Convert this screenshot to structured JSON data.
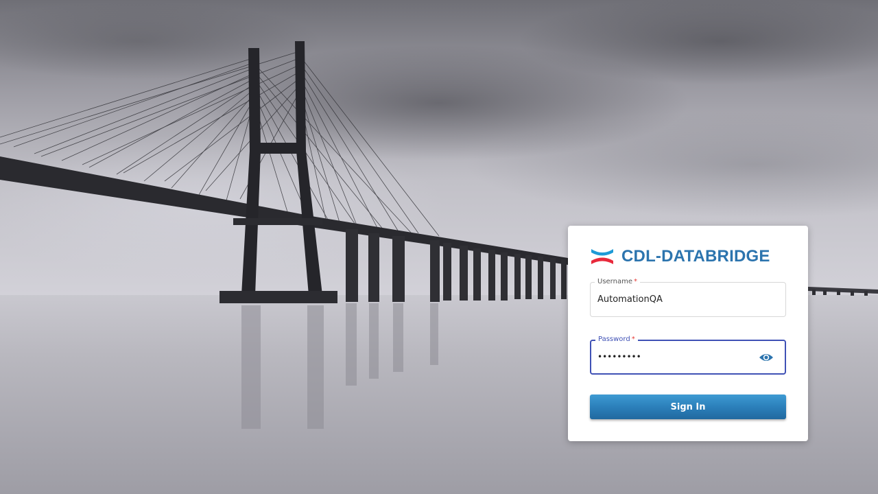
{
  "brand": {
    "name": "CDL-DATABRIDGE",
    "logo_icon": "databridge-logo-icon",
    "colors": {
      "primary": "#2c74ae",
      "accent": "#e8293b",
      "logo_blue": "#1e9ad6"
    }
  },
  "form": {
    "username": {
      "label": "Username",
      "required_mark": "*",
      "value": "AutomationQA"
    },
    "password": {
      "label": "Password",
      "required_mark": "*",
      "value": "•••••••••",
      "toggle_icon": "eye-icon",
      "focus_color": "#3f51b5"
    },
    "submit_label": "Sign In"
  },
  "background": {
    "description_icon": "bridge-background-image"
  }
}
